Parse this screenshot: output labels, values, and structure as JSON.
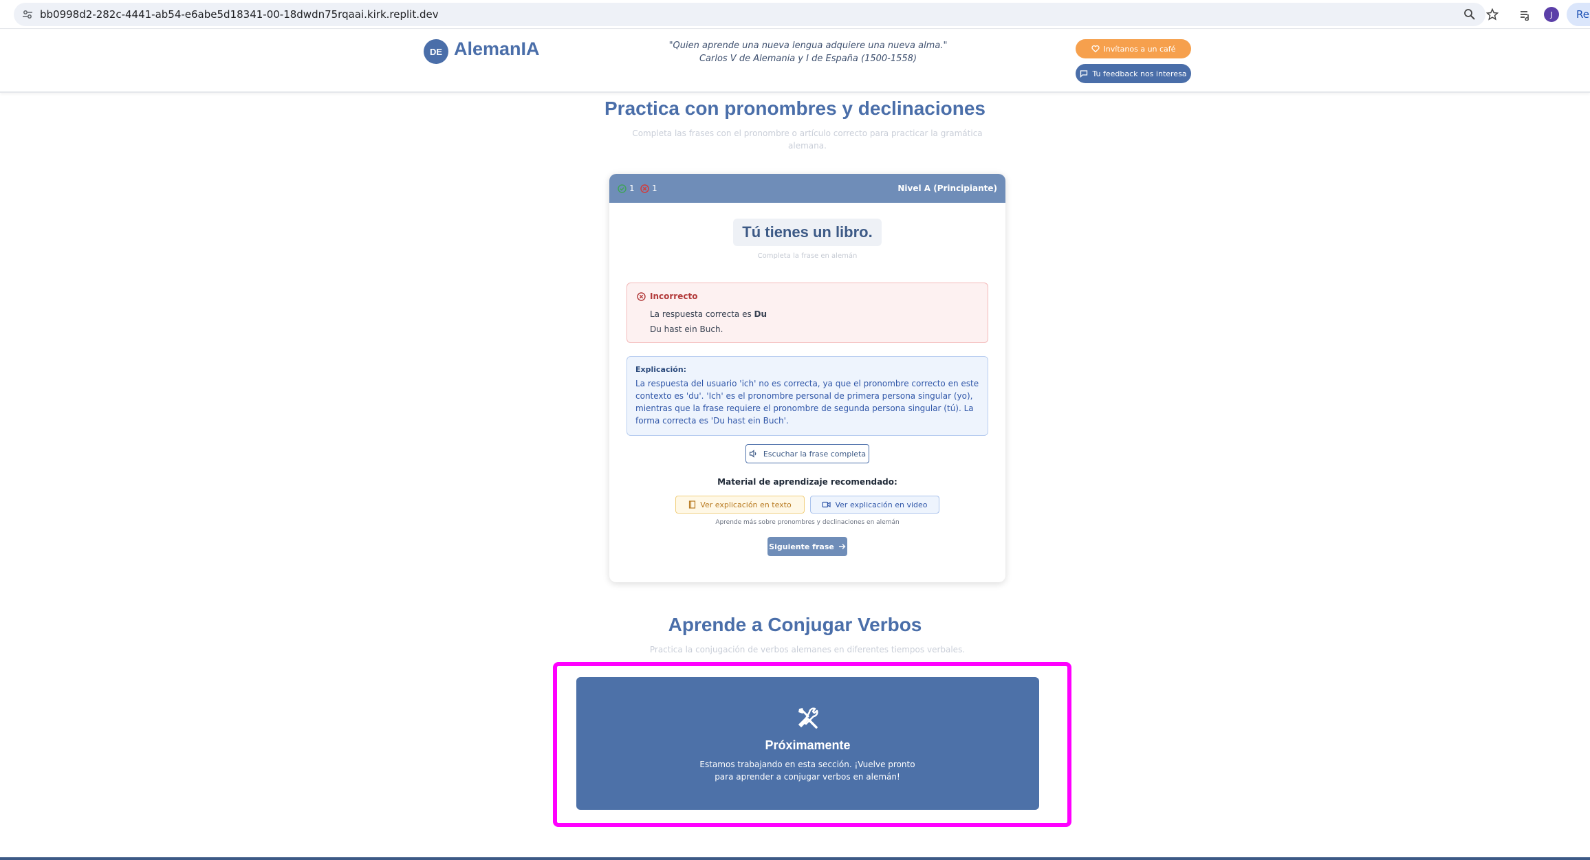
{
  "browser": {
    "url": "bb0998d2-282c-4441-ab54-e6abe5d18341-00-18dwdn75rqaai.kirk.replit.dev",
    "profile_initial": "J",
    "right_button_label": "Re"
  },
  "header": {
    "logo_badge": "DE",
    "logo_text": "AlemanIA",
    "quote_line1": "\"Quien aprende una nueva lengua adquiere una nueva alma.\"",
    "quote_line2": "Carlos V de Alemania y I de España (1500-1558)",
    "coffee_button": "Invítanos a un café",
    "feedback_button": "Tu feedback nos interesa"
  },
  "pronouns_section": {
    "title": "Practica con pronombres y declinaciones",
    "subtitle_line1": "Completa las frases con el pronombre o artículo correcto para practicar la gramática",
    "subtitle_line2": "alemana.",
    "card": {
      "correct_count": "1",
      "incorrect_count": "1",
      "level": "Nivel A (Principiante)",
      "sentence": "Tú tienes un libro.",
      "sentence_hint": "Completa la frase en alemán",
      "result": {
        "title": "Incorrecto",
        "answer_prefix": "La respuesta correcta es",
        "answer_value": "Du",
        "full_sentence": "Du hast ein Buch."
      },
      "explanation": {
        "title": "Explicación:",
        "text": "La respuesta del usuario 'ich' no es correcta, ya que el pronombre correcto en este contexto es 'du'. 'Ich' es el pronombre personal de primera persona singular (yo), mientras que la frase requiere el pronombre de segunda persona singular (tú). La forma correcta es 'Du hast ein Buch'."
      },
      "listen_button": "Escuchar la frase completa",
      "material_title": "Material de aprendizaje recomendado:",
      "text_button": "Ver explicación en texto",
      "video_button": "Ver explicación en video",
      "material_hint": "Aprende más sobre pronombres y declinaciones en alemán",
      "next_button": "Siguiente frase"
    }
  },
  "verbs_section": {
    "title": "Aprende a Conjugar Verbos",
    "subtitle": "Practica la conjugación de verbos alemanes en diferentes tiempos verbales.",
    "coming_soon": {
      "icon": "tools-icon",
      "title": "Próximamente",
      "text": "Estamos trabajando en esta sección. ¡Vuelve pronto para aprender a conjugar verbos en alemán!"
    }
  },
  "colors": {
    "brand": "#4a6ea9",
    "coffee": "#f6a04d",
    "highlight": "#ff00ff",
    "error": "#b23a3a"
  }
}
